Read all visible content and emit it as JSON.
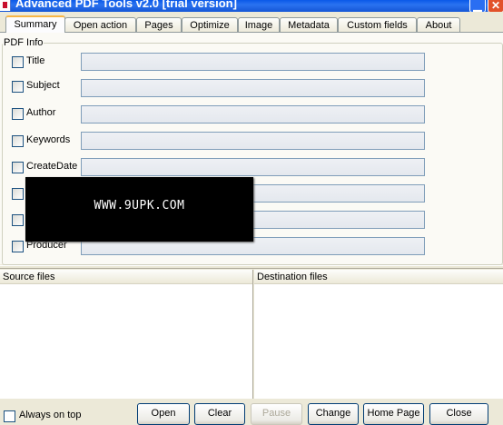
{
  "window": {
    "title": "Advanced PDF Tools  v2.0 [trial version]",
    "min_glyph": "▁",
    "close_glyph": "✕"
  },
  "tabs": [
    {
      "label": "Summary",
      "active": true
    },
    {
      "label": "Open action"
    },
    {
      "label": "Pages"
    },
    {
      "label": "Optimize"
    },
    {
      "label": "Image"
    },
    {
      "label": "Metadata"
    },
    {
      "label": "Custom fields"
    },
    {
      "label": "About"
    }
  ],
  "pdf_info": {
    "legend": "PDF Info",
    "fields": [
      {
        "label": "Title",
        "value": "",
        "checked": false
      },
      {
        "label": "Subject",
        "value": "",
        "checked": false
      },
      {
        "label": "Author",
        "value": "",
        "checked": false
      },
      {
        "label": "Keywords",
        "value": "",
        "checked": false
      },
      {
        "label": "CreateDate",
        "value": "",
        "checked": false
      },
      {
        "label": "",
        "value": "",
        "checked": false
      },
      {
        "label": "",
        "value": "",
        "checked": false
      },
      {
        "label": "Producer",
        "value": "",
        "checked": false
      }
    ]
  },
  "watermark": {
    "text": "WWW.9UPK.COM"
  },
  "lists": {
    "source_header": "Source files",
    "destination_header": "Destination files"
  },
  "footer": {
    "always_on_top_label": "Always on top",
    "buttons": {
      "open": "Open",
      "clear": "Clear",
      "pause": "Pause",
      "change": "Change",
      "home_page": "Home Page",
      "close": "Close"
    }
  }
}
